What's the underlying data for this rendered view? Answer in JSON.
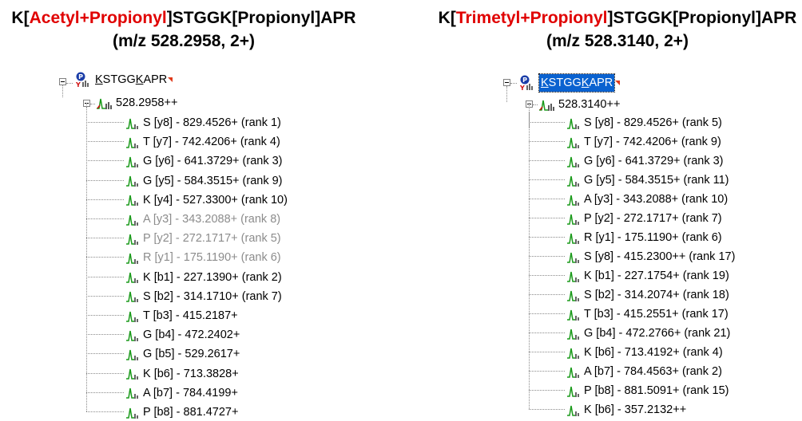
{
  "left": {
    "heading_line1_pre": "K[",
    "heading_line1_red": "Acetyl+Propionyl",
    "heading_line1_post": "]STGGK[Propionyl]APR",
    "heading_line2": "(m/z 528.2958, 2+)",
    "peptide": {
      "k1": "K",
      "mid": "STGG",
      "k2": "K",
      "rest": "APR"
    },
    "precursor": "528.2958++",
    "transitions": [
      {
        "text": "S [y8] - 829.4526+ (rank 1)",
        "dim": false
      },
      {
        "text": "T [y7] - 742.4206+ (rank 4)",
        "dim": false
      },
      {
        "text": "G [y6] - 641.3729+ (rank 3)",
        "dim": false
      },
      {
        "text": "G [y5] - 584.3515+ (rank 9)",
        "dim": false
      },
      {
        "text": "K [y4] - 527.3300+ (rank 10)",
        "dim": false
      },
      {
        "text": "A [y3] - 343.2088+ (rank 8)",
        "dim": true
      },
      {
        "text": "P [y2] - 272.1717+ (rank 5)",
        "dim": true
      },
      {
        "text": "R [y1] - 175.1190+ (rank 6)",
        "dim": true
      },
      {
        "text": "K [b1] - 227.1390+ (rank 2)",
        "dim": false
      },
      {
        "text": "S [b2] - 314.1710+ (rank 7)",
        "dim": false
      },
      {
        "text": "T [b3] - 415.2187+",
        "dim": false
      },
      {
        "text": "G [b4] - 472.2402+",
        "dim": false
      },
      {
        "text": "G [b5] - 529.2617+",
        "dim": false
      },
      {
        "text": "K [b6] - 713.3828+",
        "dim": false
      },
      {
        "text": "A [b7] - 784.4199+",
        "dim": false
      },
      {
        "text": "P [b8] - 881.4727+",
        "dim": false
      }
    ]
  },
  "right": {
    "heading_line1_pre": "K[",
    "heading_line1_red": "Trimetyl+Propionyl",
    "heading_line1_post": "]STGGK[Propionyl]APR",
    "heading_line2": "(m/z 528.3140, 2+)",
    "peptide": {
      "k1": "K",
      "mid": "STGG",
      "k2": "K",
      "rest": "APR"
    },
    "precursor": "528.3140++",
    "transitions": [
      {
        "text": "S [y8] - 829.4526+ (rank 5)",
        "dim": false
      },
      {
        "text": "T [y7] - 742.4206+ (rank 9)",
        "dim": false
      },
      {
        "text": "G [y6] - 641.3729+ (rank 3)",
        "dim": false
      },
      {
        "text": "G [y5] - 584.3515+ (rank 11)",
        "dim": false
      },
      {
        "text": "A [y3] - 343.2088+ (rank 10)",
        "dim": false
      },
      {
        "text": "P [y2] - 272.1717+ (rank 7)",
        "dim": false
      },
      {
        "text": "R [y1] - 175.1190+ (rank 6)",
        "dim": false
      },
      {
        "text": "S [y8] - 415.2300++ (rank 17)",
        "dim": false
      },
      {
        "text": "K [b1] - 227.1754+ (rank 19)",
        "dim": false
      },
      {
        "text": "S [b2] - 314.2074+ (rank 18)",
        "dim": false
      },
      {
        "text": "T [b3] - 415.2551+ (rank 17)",
        "dim": false
      },
      {
        "text": "G [b4] - 472.2766+ (rank 21)",
        "dim": false
      },
      {
        "text": "K [b6] - 713.4192+ (rank 4)",
        "dim": false
      },
      {
        "text": "A [b7] - 784.4563+ (rank 2)",
        "dim": false
      },
      {
        "text": "P [b8] - 881.5091+ (rank 15)",
        "dim": false
      },
      {
        "text": "K [b6] - 357.2132++",
        "dim": false
      }
    ]
  },
  "colors": {
    "highlight_red": "#e00000",
    "peak_green": "#1a9a1a",
    "selection_blue": "#0a62d0"
  }
}
